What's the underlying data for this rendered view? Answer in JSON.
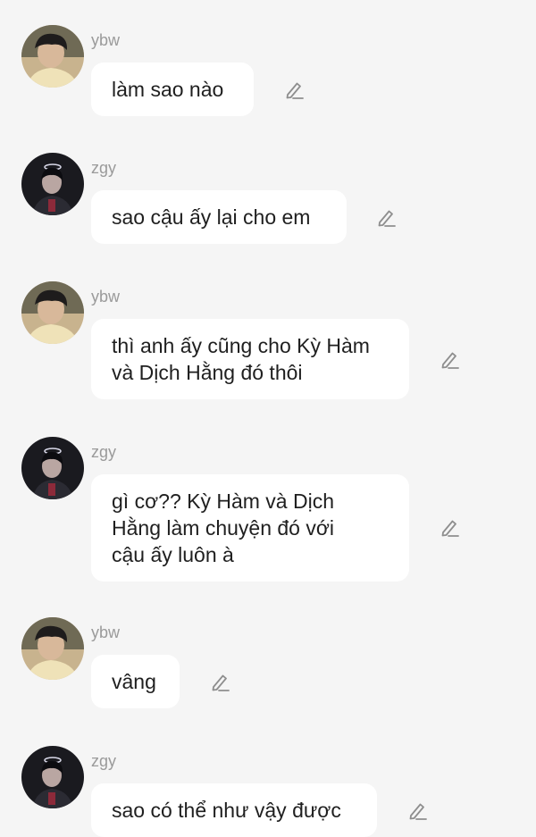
{
  "colors": {
    "background": "#f5f5f5",
    "bubble": "#ffffff",
    "name_text": "#9a9a9a",
    "message_text": "#1f1f1f",
    "edit_icon": "#8e8e8e"
  },
  "messages": [
    {
      "sender": "ybw",
      "avatar": "avatar-ybw",
      "lines": [
        "làm sao nào"
      ],
      "edit_icon": "pencil-icon"
    },
    {
      "sender": "zgy",
      "avatar": "avatar-zgy",
      "lines": [
        "sao cậu ấy lại cho em"
      ],
      "edit_icon": "pencil-icon"
    },
    {
      "sender": "ybw",
      "avatar": "avatar-ybw",
      "lines": [
        "thì anh ấy cũng cho Kỳ Hàm",
        "và Dịch Hằng đó thôi"
      ],
      "edit_icon": "pencil-icon"
    },
    {
      "sender": "zgy",
      "avatar": "avatar-zgy",
      "lines": [
        "gì cơ?? Kỳ Hàm và Dịch",
        "Hằng làm chuyện đó với",
        "cậu ấy luôn à"
      ],
      "edit_icon": "pencil-icon"
    },
    {
      "sender": "ybw",
      "avatar": "avatar-ybw",
      "lines": [
        "vâng"
      ],
      "edit_icon": "pencil-icon"
    },
    {
      "sender": "zgy",
      "avatar": "avatar-zgy",
      "lines": [
        "sao có thể như vậy được"
      ],
      "edit_icon": "pencil-icon"
    }
  ]
}
